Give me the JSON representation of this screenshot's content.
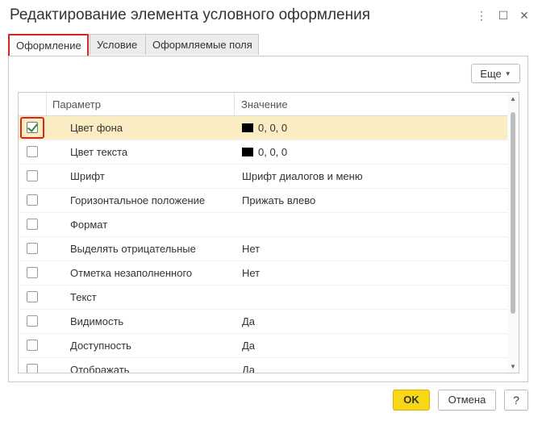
{
  "window": {
    "title": "Редактирование элемента условного оформления",
    "more_icon": "more-vertical-icon",
    "maximize_icon": "maximize-icon",
    "close_icon": "close-icon"
  },
  "tabs": [
    {
      "label": "Оформление",
      "active": true
    },
    {
      "label": "Условие",
      "active": false
    },
    {
      "label": "Оформляемые поля",
      "active": false
    }
  ],
  "toolbar": {
    "more_label": "Еще"
  },
  "grid": {
    "columns": {
      "param": "Параметр",
      "value": "Значение"
    },
    "rows": [
      {
        "checked": true,
        "name": "Цвет фона",
        "value": "0, 0, 0",
        "swatch": "#000000",
        "selected": true
      },
      {
        "checked": false,
        "name": "Цвет текста",
        "value": "0, 0, 0",
        "swatch": "#000000",
        "selected": false
      },
      {
        "checked": false,
        "name": "Шрифт",
        "value": "Шрифт диалогов и меню",
        "selected": false
      },
      {
        "checked": false,
        "name": "Горизонтальное положение",
        "value": "Прижать влево",
        "selected": false
      },
      {
        "checked": false,
        "name": "Формат",
        "value": "",
        "selected": false
      },
      {
        "checked": false,
        "name": "Выделять отрицательные",
        "value": "Нет",
        "selected": false
      },
      {
        "checked": false,
        "name": "Отметка незаполненного",
        "value": "Нет",
        "selected": false
      },
      {
        "checked": false,
        "name": "Текст",
        "value": "",
        "selected": false
      },
      {
        "checked": false,
        "name": "Видимость",
        "value": "Да",
        "selected": false
      },
      {
        "checked": false,
        "name": "Доступность",
        "value": "Да",
        "selected": false
      },
      {
        "checked": false,
        "name": "Отображать",
        "value": "Да",
        "selected": false
      }
    ]
  },
  "footer": {
    "ok_label": "OK",
    "cancel_label": "Отмена",
    "help_label": "?"
  },
  "colors": {
    "accent_yellow": "#f7d716",
    "selection": "#faecc3",
    "highlight_red": "#d9261c"
  }
}
